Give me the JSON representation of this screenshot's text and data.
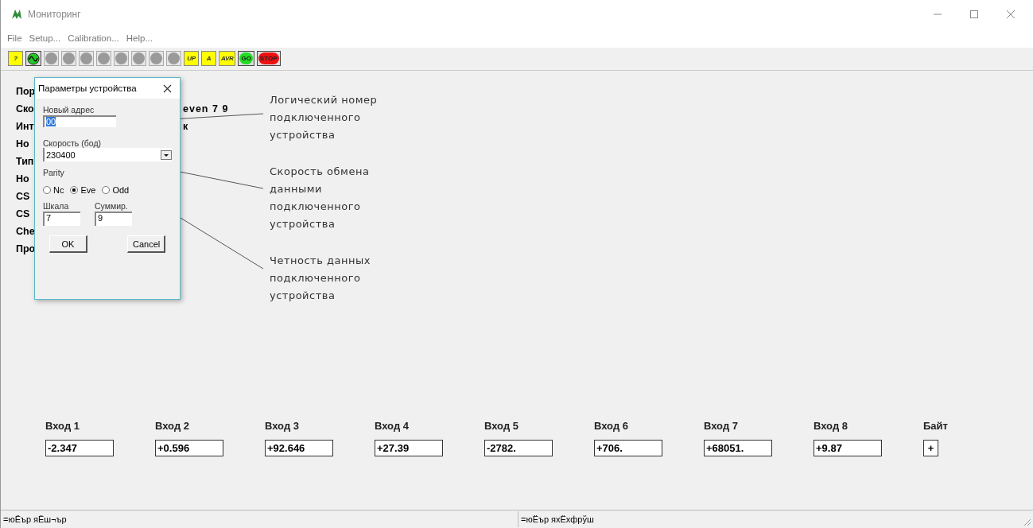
{
  "window": {
    "title": "Мониторинг"
  },
  "menu": [
    "File",
    "Setup...",
    "Calibration...",
    "Help..."
  ],
  "toolbar": [
    {
      "kind": "text",
      "label": "?"
    },
    {
      "kind": "wave",
      "color": "#22cc22",
      "disabled": false
    },
    {
      "kind": "circle",
      "color": "#9a9a9a",
      "disabled": true
    },
    {
      "kind": "circle",
      "color": "#9a9a9a",
      "disabled": true
    },
    {
      "kind": "circle",
      "color": "#9a9a9a",
      "disabled": true
    },
    {
      "kind": "circle",
      "color": "#9a9a9a",
      "disabled": true
    },
    {
      "kind": "circle",
      "color": "#9a9a9a",
      "disabled": true
    },
    {
      "kind": "circle",
      "color": "#9a9a9a",
      "disabled": true
    },
    {
      "kind": "circle",
      "color": "#9a9a9a",
      "disabled": true
    },
    {
      "kind": "circle",
      "color": "#9a9a9a",
      "disabled": true
    },
    {
      "kind": "text",
      "label": "UP"
    },
    {
      "kind": "text",
      "label": "A"
    },
    {
      "kind": "text",
      "label": "AVR"
    },
    {
      "kind": "circle",
      "color": "#22dd22",
      "label": "GO",
      "disabled": false
    },
    {
      "kind": "circle",
      "color": "#ee1111",
      "label": "STOP",
      "disabled": false
    }
  ],
  "info_rows": [
    {
      "left": "Пор"
    },
    {
      "left": "Ско",
      "right": "even 7 9"
    },
    {
      "left": "Инт",
      "right": "к"
    },
    {
      "left": "Но"
    },
    {
      "left": "Тип"
    },
    {
      "left": "Но"
    },
    {
      "left": "CS"
    },
    {
      "left": "CS"
    },
    {
      "left": "Che"
    },
    {
      "left": "Про"
    }
  ],
  "dialog": {
    "title": "Параметры устройства",
    "address": {
      "label": "Новый адрес",
      "value": "00"
    },
    "speed": {
      "label": "Скорость (бод)",
      "value": "230400"
    },
    "parity": {
      "label": "Parity",
      "options": [
        {
          "label": "Nc",
          "selected": false
        },
        {
          "label": "Eve",
          "selected": true
        },
        {
          "label": "Odd",
          "selected": false
        }
      ]
    },
    "scale": {
      "label": "Шкала",
      "value": "7"
    },
    "sum": {
      "label": "Суммир.",
      "value": "9"
    },
    "buttons": [
      "OK",
      "Cancel"
    ]
  },
  "annotations": [
    "Логический номер\nподключенного\nустройства",
    "Скорость обмена\nданными\nподключенного\nустройства",
    "Четность данных\nподключенного\nустройства"
  ],
  "inputs": [
    {
      "label": "Вход 1",
      "value": "-2.347"
    },
    {
      "label": "Вход 2",
      "value": "+0.596"
    },
    {
      "label": "Вход 3",
      "value": "+92.646"
    },
    {
      "label": "Вход 4",
      "value": "+27.39"
    },
    {
      "label": "Вход 5",
      "value": "-2782."
    },
    {
      "label": "Вход 6",
      "value": "+706."
    },
    {
      "label": "Вход 7",
      "value": "+68051."
    },
    {
      "label": "Вход 8",
      "value": "+9.87"
    },
    {
      "label": "Байт",
      "value": "+",
      "kind": "byte"
    }
  ],
  "status_bar": [
    "=юЁър яЁш¬ър",
    "=юЁър яхЁхфрўш"
  ]
}
